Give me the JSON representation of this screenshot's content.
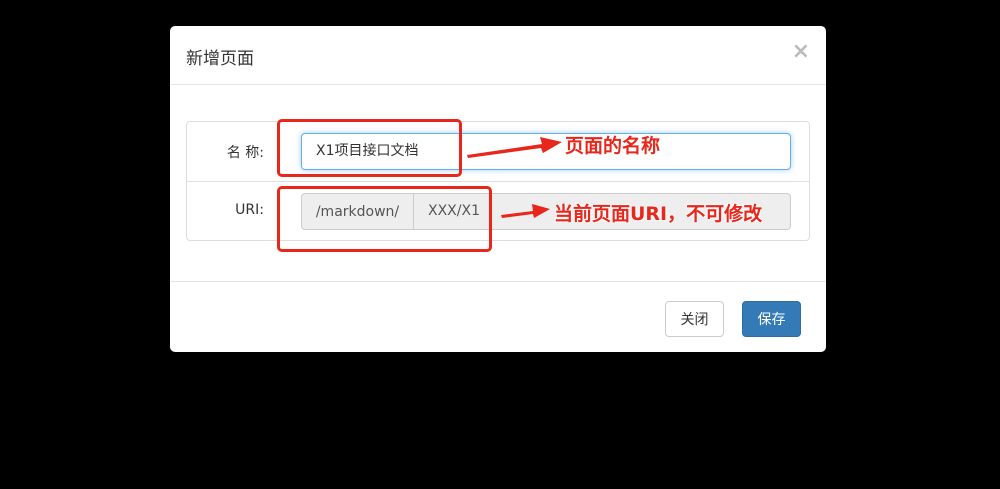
{
  "modal": {
    "title": "新增页面",
    "close_symbol": "×",
    "close_icon": "close-icon"
  },
  "form": {
    "name_label": "名 称:",
    "name_value": "X1项目接口文档",
    "uri_label": "URI:",
    "uri_prefix": "/markdown/",
    "uri_value": "XXX/X1"
  },
  "annotations": {
    "name_note": "页面的名称",
    "uri_note": "当前页面URI，不可修改",
    "color": "#e8261b"
  },
  "footer": {
    "close_label": "关闭",
    "save_label": "保存"
  },
  "colors": {
    "primary": "#337ab7",
    "focus_border": "#66afe9",
    "backdrop": "#000000"
  }
}
